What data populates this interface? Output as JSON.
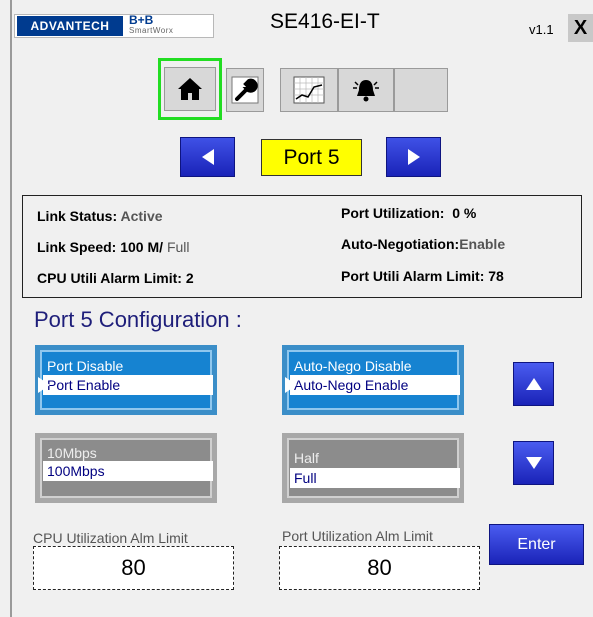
{
  "header": {
    "brand_primary": "ADVANTECH",
    "brand_secondary": "B+B",
    "brand_tertiary": "SmartWorx",
    "title": "SE416-EI-T",
    "version": "v1.1",
    "close_label": "X"
  },
  "toolbar": {
    "buttons": [
      {
        "icon": "home-icon",
        "active": true
      },
      {
        "icon": "wrench-icon"
      },
      {
        "icon": "chart-icon"
      },
      {
        "icon": "alarm-bell-icon"
      },
      {
        "icon": "blank"
      }
    ]
  },
  "port_nav": {
    "current_port": "Port 5"
  },
  "status": {
    "link_status_label": "Link Status:",
    "link_status_value": "Active",
    "link_speed_label": "Link Speed: 100 M/",
    "link_speed_duplex": "Full",
    "cpu_alarm_label": "CPU Utili Alarm Limit: 2",
    "port_util_label": "Port Utilization:",
    "port_util_value": "0 %",
    "autoneg_label": "Auto-Negotiation:",
    "autoneg_value": "Enable",
    "port_alarm_label": "Port Utili Alarm Limit: 78"
  },
  "config": {
    "title": "Port 5 Configuration :",
    "port_state": {
      "options": [
        "Port Disable",
        "Port Enable"
      ],
      "selected": "Port Enable"
    },
    "autoneg": {
      "options": [
        "Auto-Nego Disable",
        "Auto-Nego Enable"
      ],
      "selected": "Auto-Nego Enable"
    },
    "speed": {
      "options": [
        "10Mbps",
        "100Mbps"
      ],
      "selected": "100Mbps"
    },
    "duplex": {
      "options": [
        "Half",
        "Full"
      ],
      "selected": "Full"
    },
    "cpu_limit_label": "CPU Utilization Alm Limit",
    "cpu_limit_value": "80",
    "port_limit_label": "Port Utilization Alm Limit",
    "port_limit_value": "80",
    "enter_label": "Enter"
  },
  "colors": {
    "accent_blue": "#1a23b8",
    "list_blue": "#1683d1",
    "port_highlight": "#ffff00",
    "active_border": "#22dd22"
  }
}
